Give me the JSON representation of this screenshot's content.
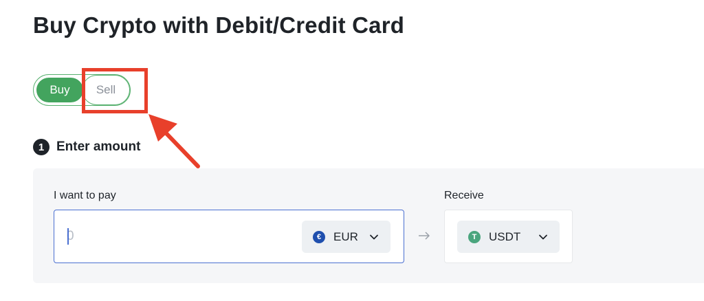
{
  "header": {
    "title": "Buy Crypto with Debit/Credit Card"
  },
  "mode_toggle": {
    "buy_label": "Buy",
    "sell_label": "Sell",
    "selected": "Buy"
  },
  "annotation": {
    "color": "#e8402b"
  },
  "step": {
    "number": "1",
    "title": "Enter amount"
  },
  "pay": {
    "label": "I want to pay",
    "value": "",
    "placeholder": "0",
    "currency": "EUR",
    "currency_icon": "euro-coin-icon",
    "currency_symbol": "€"
  },
  "receive": {
    "label": "Receive",
    "currency": "USDT",
    "currency_icon": "tether-coin-icon",
    "currency_symbol": "T"
  },
  "colors": {
    "accent_green": "#43a45e",
    "focus_blue": "#4a6fd1"
  }
}
